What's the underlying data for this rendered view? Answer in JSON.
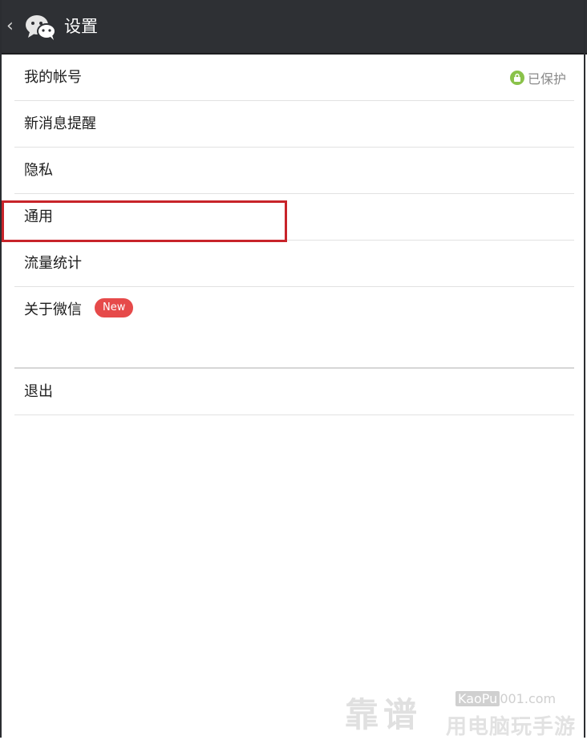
{
  "header": {
    "back_icon": "chevron-left-icon",
    "logo_icon": "wechat-logo-icon",
    "title": "设置"
  },
  "settings": {
    "items": [
      {
        "label": "我的帐号",
        "status": "已保护",
        "status_icon": "lock-icon"
      },
      {
        "label": "新消息提醒"
      },
      {
        "label": "隐私"
      },
      {
        "label": "通用",
        "highlighted": true
      },
      {
        "label": "流量统计"
      },
      {
        "label": "关于微信",
        "badge": "New"
      }
    ],
    "logout_label": "退出"
  },
  "watermark": {
    "brand": "靠谱",
    "site_prefix": "KaoPu",
    "site_suffix": "001.com",
    "tagline": "用电脑玩手游"
  },
  "colors": {
    "header_bg": "#2e3034",
    "badge_bg": "#e64a4a",
    "protect_green": "#8ac24a",
    "highlight_red": "#c8242a",
    "divider": "#e2e2e2"
  }
}
